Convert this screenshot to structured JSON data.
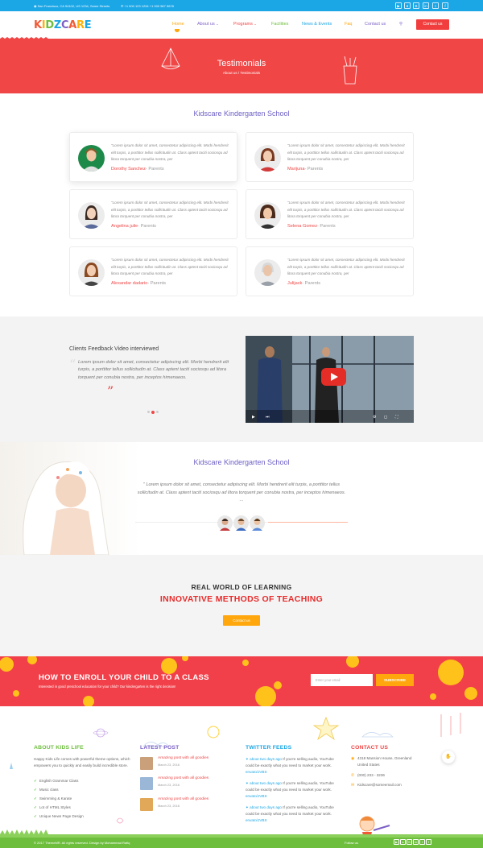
{
  "topbar": {
    "address": "San Francisco, CA 94102, US 1234, Some Streets",
    "phones": "+1 000 123 1234  +1 000 567 5678",
    "social_icons": [
      "youtube-icon",
      "flickr-icon",
      "behance-icon",
      "linkedin-icon",
      "twitter-icon",
      "facebook-icon"
    ]
  },
  "brand": {
    "logo_letters": [
      "K",
      "I",
      "D",
      "Z",
      "C",
      "A",
      "R",
      "E"
    ],
    "logo_colors": [
      "#f15a36",
      "#ffb20a",
      "#6dbe3d",
      "#1ba6e6",
      "#7b5fc6",
      "#f15a36",
      "#ffb20a",
      "#1ba6e6"
    ]
  },
  "nav": {
    "items": [
      "Home",
      "About us",
      "Programs",
      "Facilities",
      "News & Events",
      "Faq",
      "Contact us"
    ],
    "item_colors": [
      "#ffa70c",
      "#7b5fc6",
      "#f04646",
      "#6dbe3d",
      "#1ba6e6",
      "#ffa70c",
      "#7b5fc6"
    ],
    "cta": "Contact us"
  },
  "hero": {
    "title": "Testimonials",
    "breadcrumb": "About us / Testimonials"
  },
  "testimonials": {
    "title": "Kidscare Kindergarten School",
    "quote": "\"Lorem ipsum dolor sit amet, consectetur adipiscing elit. Morbi hendrerit elit turpis, a porttitor tellus sollicitudin at. Class aptent taciti sociosqu ad litora torquent per conubia nostra, per",
    "role": "- Parents",
    "items": [
      {
        "name": "Dorothy Sanchez"
      },
      {
        "name": "Marijuna"
      },
      {
        "name": "Angelina julie"
      },
      {
        "name": "Selena Gomez"
      },
      {
        "name": "Alexandar dadario"
      },
      {
        "name": "Julijack"
      }
    ]
  },
  "video_section": {
    "title": "Clients Feedback Video interviewed",
    "quote": "Lorem ipsum dolor sit amet, consectetur adipiscing elit. Morbi hendrerit elit turpis, a porttitor tellus sollicitudin at. Class aptent taciti sociosqu ad litora torquent per conubia nostra, per inceptos himenaeos."
  },
  "school_section": {
    "title": "Kidscare Kindergarten School",
    "quote": "\" Lorem ipsum dolor sit amet, consectetur adipiscing elit. Morbi hendrerit elit turpis, a porttitor tellus sollicitudin at. Class aptent taciti sociosqu ad litora torquent per conubia nostra, per inceptos himenaeos. ..."
  },
  "methods": {
    "line1": "REAL WORLD OF LEARNING",
    "line2": "INNOVATIVE METHODS OF TEACHING",
    "button": "Contact us"
  },
  "enroll": {
    "title": "HOW TO ENROLL YOUR CHILD TO A CLASS",
    "subtitle": "Interested in good preschool education for your child? Our kindergarten is the right decision!",
    "email_placeholder": "Enter your email",
    "button": "SUBSCRIBE"
  },
  "footer": {
    "about": {
      "title": "ABOUT KIDS LIFE",
      "text": "Happy Kids Life comes with powerful theme options, which empowers you to quickly and easily build incredible store.",
      "list": [
        "English Grammar Class",
        "Music class",
        "Swimming & Karate",
        "Lot of HTML Styles",
        "Unique News Page Design"
      ]
    },
    "latest": {
      "title": "LATEST POST",
      "posts": [
        {
          "title": "Amazing post with all goodies",
          "date": "March 23, 2016"
        },
        {
          "title": "Amazing post with all goodies",
          "date": "March 23, 2016"
        },
        {
          "title": "Amazing post with all goodies",
          "date": "March 23, 2016"
        }
      ]
    },
    "twitter": {
      "title": "TWITTER FEEDS",
      "tweets": [
        {
          "when": "about two days ago",
          "text": " If you're selling audio, YouTube could be exactly what you need to market your work.",
          "tag": "envato/JVBS"
        },
        {
          "when": "about two days ago",
          "text": " If you're selling audio, YouTube could be exactly what you need to market your work.",
          "tag": "envato/JVBS"
        },
        {
          "when": "about two days ago",
          "text": " If you're selling audio, YouTube could be exactly what you need to market your work.",
          "tag": "envato/JVBS"
        }
      ]
    },
    "contact": {
      "title": "CONTACT US",
      "address": "4318 Mansion House, Greenland United States",
      "phone": "(000) 233 - 3236",
      "email": "Kidscare@someemail.com"
    },
    "heading_colors": [
      "#6dbe3d",
      "#7b5fc6",
      "#1ba6e6",
      "#f04646"
    ]
  },
  "bottom": {
    "copyright": "© 2017 ThemeMR. All rights reserved. Design by Mohammad Rafiq",
    "follow": "Follow us"
  }
}
